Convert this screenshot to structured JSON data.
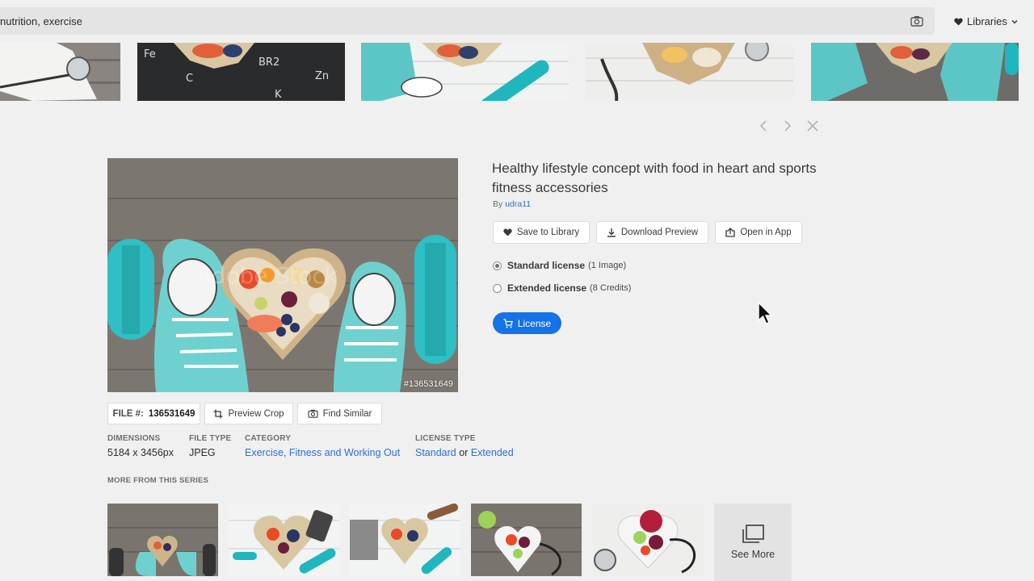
{
  "search": {
    "value": "nutrition, exercise"
  },
  "header": {
    "libraries_label": "Libraries"
  },
  "asset": {
    "title": "Healthy lifestyle concept with food in heart and sports fitness accessories",
    "by_prefix": "By",
    "author": "udra11",
    "preview_id": "#136531649",
    "file_label": "FILE #:",
    "file_number": "136531649"
  },
  "actions": {
    "save": "Save to Library",
    "download": "Download Preview",
    "open": "Open in App",
    "preview_crop": "Preview Crop",
    "find_similar": "Find Similar",
    "license_button": "License"
  },
  "license_options": [
    {
      "label": "Standard license",
      "detail": "(1 Image)",
      "selected": true
    },
    {
      "label": "Extended license",
      "detail": "(8 Credits)",
      "selected": false
    }
  ],
  "meta": {
    "dimensions_label": "DIMENSIONS",
    "dimensions": "5184 x 3456px",
    "file_type_label": "FILE TYPE",
    "file_type": "JPEG",
    "category_label": "CATEGORY",
    "category": "Exercise, Fitness and Working Out",
    "license_type_label": "LICENSE TYPE",
    "license_standard": "Standard",
    "license_or": "or",
    "license_extended": "Extended"
  },
  "series": {
    "label": "MORE FROM THIS SERIES",
    "see_more": "See More"
  },
  "colors": {
    "accent": "#1473e6",
    "link": "#2d6fd6",
    "background": "#f0f0f0"
  }
}
